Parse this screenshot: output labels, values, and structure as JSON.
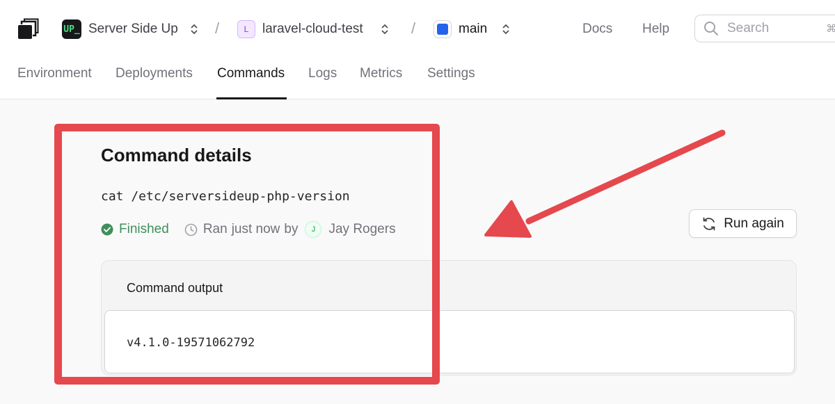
{
  "topbar": {
    "org": {
      "badge": "UP_",
      "name": "Server Side Up"
    },
    "app": {
      "badge": "L",
      "name": "laravel-cloud-test"
    },
    "env": {
      "name": "main",
      "color": "#2563eb"
    },
    "separator": "/",
    "links": {
      "docs": "Docs",
      "help": "Help"
    },
    "search": {
      "placeholder": "Search",
      "shortcut": "⌘"
    }
  },
  "tabs": [
    {
      "label": "Environment",
      "active": false
    },
    {
      "label": "Deployments",
      "active": false
    },
    {
      "label": "Commands",
      "active": true
    },
    {
      "label": "Logs",
      "active": false
    },
    {
      "label": "Metrics",
      "active": false
    },
    {
      "label": "Settings",
      "active": false
    }
  ],
  "command": {
    "title": "Command details",
    "text": "cat /etc/serversideup-php-version",
    "status": "Finished",
    "ran_label": "Ran",
    "ran_time": "just now",
    "by_label": "by",
    "user_initial": "J",
    "user_name": "Jay Rogers",
    "run_again_label": "Run again",
    "output_title": "Command output",
    "output": "v4.1.0-19571062792"
  },
  "colors": {
    "annotation": "#e5484d",
    "status_green": "#3f8f5b",
    "env_blue": "#2563eb"
  },
  "icons": [
    "app-logo-icon",
    "chevron-updown-icon",
    "search-icon",
    "check-circle-icon",
    "clock-icon",
    "refresh-icon",
    "annotation-arrow"
  ]
}
